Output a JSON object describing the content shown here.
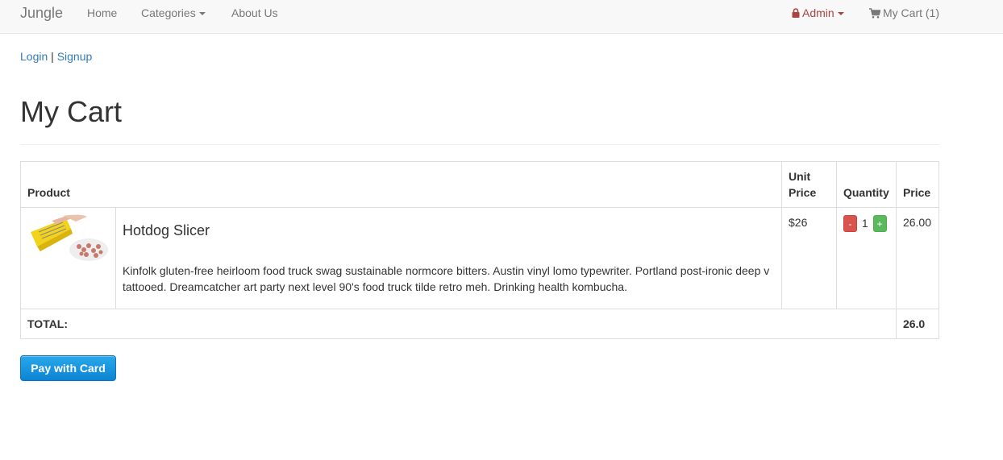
{
  "nav": {
    "brand": "Jungle",
    "home": "Home",
    "categories": "Categories",
    "about": "About Us",
    "admin": "Admin",
    "cart": "My Cart (1)"
  },
  "auth": {
    "login": "Login",
    "separator": "|",
    "signup": "Signup"
  },
  "page": {
    "title": "My Cart"
  },
  "table": {
    "headers": {
      "product": "Product",
      "unit_price": "Unit Price",
      "quantity": "Quantity",
      "price": "Price"
    },
    "items": [
      {
        "name": "Hotdog Slicer",
        "description": "Kinfolk gluten-free heirloom food truck swag sustainable normcore bitters. Austin vinyl lomo typewriter. Portland post-ironic deep v tattooed. Dreamcatcher art party next level 90's food truck tilde retro meh. Drinking health kombucha.",
        "unit_price": "$26",
        "quantity": "1",
        "minus_label": "-",
        "plus_label": "+",
        "price": "26.00"
      }
    ],
    "total_label": "TOTAL:",
    "total_value": "26.0"
  },
  "pay": {
    "label": "Pay with Card"
  },
  "colors": {
    "admin": "#a94442",
    "link": "#337ab7",
    "pay": "#1a96e0",
    "minus": "#d9534f",
    "plus": "#5cb85c"
  }
}
